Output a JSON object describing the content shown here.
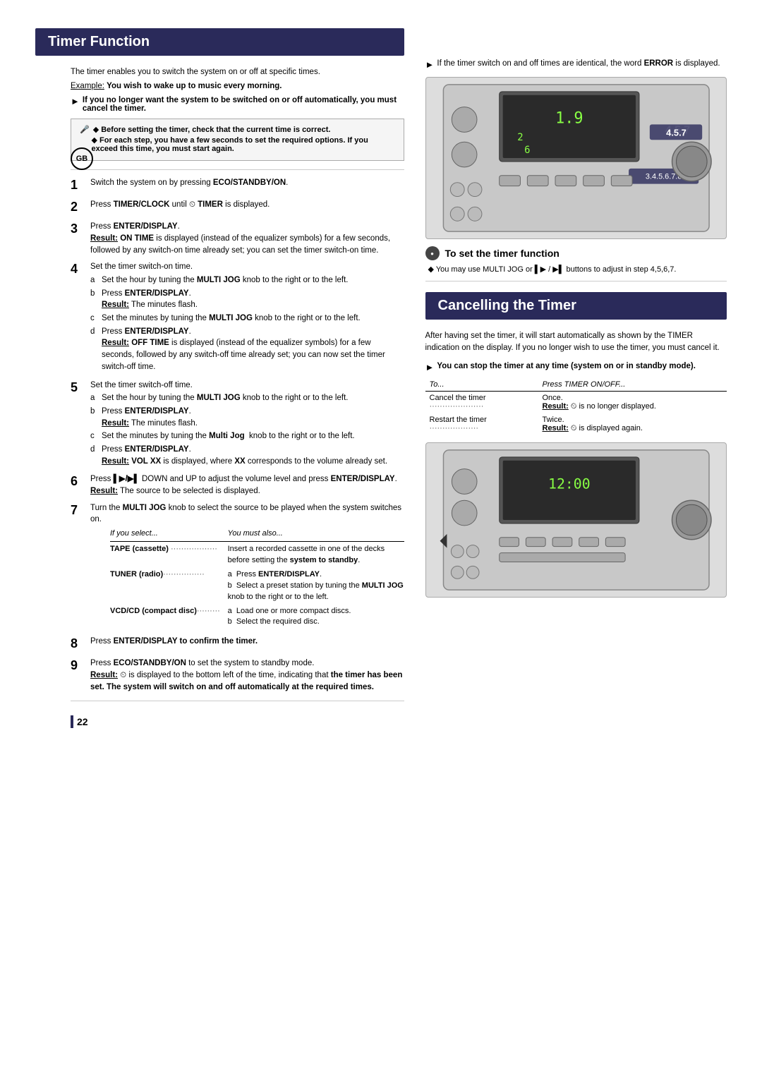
{
  "page": {
    "number": "22",
    "sections": {
      "timer_function": {
        "title": "Timer Function",
        "intro": "The timer enables you to switch the system on or off at specific times.",
        "example_label": "Example:",
        "example_text": "You wish to wake up to music every morning.",
        "warning": {
          "text": "If you no longer want the system to be switched on or off automatically, you must cancel the timer."
        },
        "notes": [
          "Before setting the timer, check that the current time is correct.",
          "For each step, you have a few seconds to set the required options. If you exceed this time, you must start again."
        ],
        "steps": [
          {
            "num": "1",
            "text": "Switch the system on by pressing ECO/STANDBY/ON."
          },
          {
            "num": "2",
            "text": "Press TIMER/CLOCK until ⏰ TIMER is displayed."
          },
          {
            "num": "3",
            "text": "Press ENTER/DISPLAY.",
            "result": "ON TIME is displayed (instead of the equalizer symbols) for a few seconds, followed by any switch-on time already set; you can set the timer switch-on time."
          },
          {
            "num": "4",
            "text": "Set the timer switch-on time.",
            "substeps": [
              {
                "letter": "a",
                "text": "Set the hour by tuning the MULTI JOG knob to the right or to the left."
              },
              {
                "letter": "b",
                "text": "Press ENTER/DISPLAY.",
                "result": "The minutes flash."
              },
              {
                "letter": "c",
                "text": "Set the minutes by tuning the MULTI JOG knob to the right or to the left."
              },
              {
                "letter": "d",
                "text": "Press ENTER/DISPLAY.",
                "result": "OFF TIME is displayed (instead of the equalizer symbols) for a few seconds, followed by any switch-off time already set; you can now set the timer switch-off time."
              }
            ]
          },
          {
            "num": "5",
            "text": "Set the timer switch-off time.",
            "substeps": [
              {
                "letter": "a",
                "text": "Set the hour by tuning the MULTI JOG knob to the right or to the left."
              },
              {
                "letter": "b",
                "text": "Press ENTER/DISPLAY.",
                "result": "The minutes flash."
              },
              {
                "letter": "c",
                "text": "Set the minutes by tuning the Multi Jog knob to the right or to the left."
              },
              {
                "letter": "d",
                "text": "Press ENTER/DISPLAY.",
                "result": "VOL XX is displayed, where XX corresponds to the volume already set."
              }
            ]
          },
          {
            "num": "6",
            "text": "Press ⏮/⏭ DOWN and UP to adjust the volume level and press ENTER/DISPLAY.",
            "result": "The source to be selected is displayed."
          },
          {
            "num": "7",
            "text": "Turn the MULTI JOG knob to select the source to be played when the system switches on.",
            "table": {
              "headers": [
                "If you select...",
                "You must also..."
              ],
              "rows": [
                {
                  "col1": "TAPE (cassette)",
                  "col2": "Insert a recorded cassette in one of the decks before setting the system to standby."
                },
                {
                  "col1": "TUNER (radio)",
                  "col2_items": [
                    "a  Press ENTER/DISPLAY.",
                    "b  Select a preset station by tuning the MULTI JOG knob to the right or to the left."
                  ]
                },
                {
                  "col1": "VCD/CD (compact disc)",
                  "col2_items": [
                    "a  Load one or more compact discs.",
                    "b  Select the required disc."
                  ]
                }
              ]
            }
          },
          {
            "num": "8",
            "text": "Press ENTER/DISPLAY to confirm the timer."
          },
          {
            "num": "9",
            "text": "Press ECO/STANDBY/ON to set the system to standby mode.",
            "result": "⏰ is displayed to the bottom left of the time, indicating that the timer has been set. The system will switch on and off automatically at the required times."
          }
        ]
      },
      "right_panel": {
        "error_note": "If the timer switch on and off times are identical, the word ERROR is displayed.",
        "to_set_title": "To set the timer function",
        "to_set_note": "◆ You may use MULTI JOG or ⏮ / ⏭ buttons to adjust in step 4,5,6,7."
      },
      "cancelling_timer": {
        "title": "Cancelling the Timer",
        "intro": "After having set the timer, it will start automatically as shown by the TIMER indication on the display. If you no longer wish to use the timer, you must cancel it.",
        "warning": "You can stop the timer at any time (system on or in standby mode).",
        "table": {
          "headers": [
            "To...",
            "Press TIMER ON/OFF..."
          ],
          "rows": [
            {
              "action": "Cancel the timer",
              "press": "Once.",
              "result": "Result: ⏰ is no longer displayed."
            },
            {
              "action": "Restart the timer",
              "press": "Twice.",
              "result": "Result: ⏰ is displayed again."
            }
          ]
        }
      }
    }
  }
}
